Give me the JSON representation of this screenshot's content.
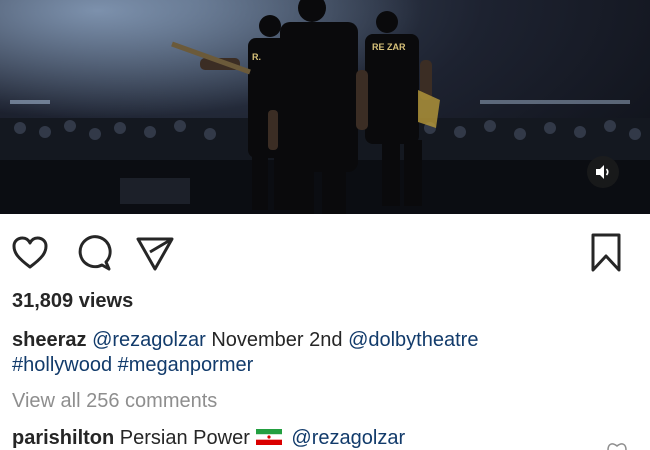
{
  "video": {
    "shirt_text_left": "R.",
    "shirt_text_right": "RE ZAR",
    "sound_icon": "speaker-icon"
  },
  "actions": {
    "like_icon": "heart-icon",
    "comment_icon": "comment-bubble-icon",
    "share_icon": "paper-plane-icon",
    "save_icon": "bookmark-icon"
  },
  "views": "31,809 views",
  "caption": {
    "username": "sheeraz",
    "mention1": "@rezagolzar",
    "text1": "November 2nd",
    "mention2": "@dolbytheatre",
    "hashtag1": "#hollywood",
    "hashtag2": "#meganpormer"
  },
  "view_all_comments": "View all 256 comments",
  "comment": {
    "username": "parishilton",
    "text": "Persian Power",
    "flag_icon": "iran-flag-icon",
    "mention": "@rezagolzar"
  },
  "colors": {
    "text": "#262626",
    "link": "#123b6b",
    "muted": "#8e8e8e"
  }
}
